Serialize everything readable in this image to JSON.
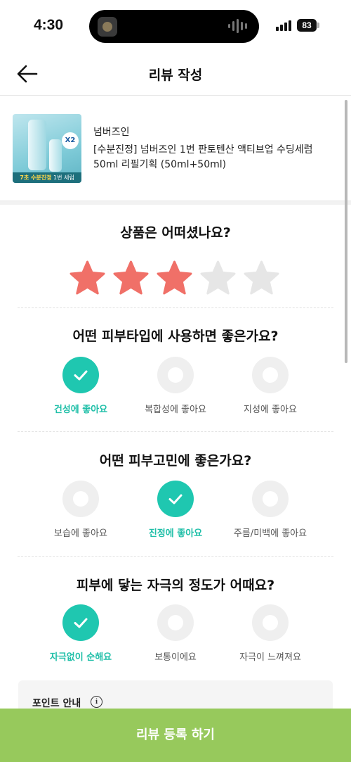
{
  "status_bar": {
    "time": "4:30",
    "battery": "83"
  },
  "header": {
    "title": "리뷰 작성"
  },
  "product": {
    "brand": "넘버즈인",
    "name": "[수분진정] 넘버즈인 1번 판토텐산 액티브업 수딩세럼 50ml 리필기획 (50ml+50ml)",
    "image_badge": "X2",
    "image_banner_highlight": "7초 수분진정",
    "image_banner_rest": "1번 세럼"
  },
  "rating": {
    "question": "상품은 어떠셨나요?",
    "value": 3,
    "max": 5,
    "filled_color": "#f07068",
    "empty_color": "#e6e6e6"
  },
  "skin_type": {
    "question": "어떤 피부타입에 사용하면 좋은가요?",
    "options": [
      {
        "label": "건성에 좋아요",
        "selected": true
      },
      {
        "label": "복합성에 좋아요",
        "selected": false
      },
      {
        "label": "지성에 좋아요",
        "selected": false
      }
    ]
  },
  "skin_concern": {
    "question": "어떤 피부고민에 좋은가요?",
    "options": [
      {
        "label": "보습에 좋아요",
        "selected": false
      },
      {
        "label": "진정에 좋아요",
        "selected": true
      },
      {
        "label": "주름/미백에 좋아요",
        "selected": false
      }
    ]
  },
  "irritation": {
    "question": "피부에 닿는 자극의 정도가 어때요?",
    "options": [
      {
        "label": "자극없이 순해요",
        "selected": true
      },
      {
        "label": "보통이에요",
        "selected": false
      },
      {
        "label": "자극이 느껴져요",
        "selected": false
      }
    ]
  },
  "point_info": {
    "title": "포인트 안내",
    "icon_text": "i"
  },
  "submit": {
    "label": "리뷰 등록 하기"
  },
  "colors": {
    "accent": "#1fc7b0",
    "submit_bg": "#97c95c",
    "star": "#f07068"
  }
}
